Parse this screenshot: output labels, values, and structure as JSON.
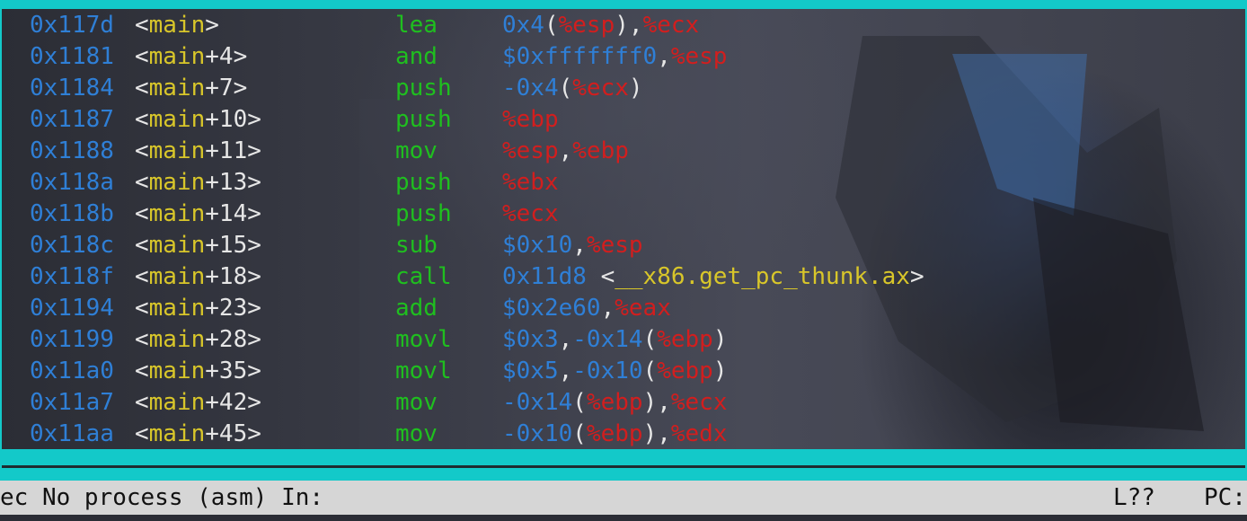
{
  "asm": {
    "rows": [
      {
        "addr": "0x117d",
        "sym": "main",
        "offset": "",
        "mnem": "lea",
        "ops": [
          [
            "num",
            "0x4"
          ],
          [
            "punc",
            "("
          ],
          [
            "reg",
            "%esp"
          ],
          [
            "punc",
            "),"
          ],
          [
            "reg",
            "%ecx"
          ]
        ]
      },
      {
        "addr": "0x1181",
        "sym": "main",
        "offset": "+4",
        "mnem": "and",
        "ops": [
          [
            "num",
            "$0xfffffff0"
          ],
          [
            "punc",
            ","
          ],
          [
            "reg",
            "%esp"
          ]
        ]
      },
      {
        "addr": "0x1184",
        "sym": "main",
        "offset": "+7",
        "mnem": "push",
        "ops": [
          [
            "num",
            "-0x4"
          ],
          [
            "punc",
            "("
          ],
          [
            "reg",
            "%ecx"
          ],
          [
            "punc",
            ")"
          ]
        ]
      },
      {
        "addr": "0x1187",
        "sym": "main",
        "offset": "+10",
        "mnem": "push",
        "ops": [
          [
            "reg",
            "%ebp"
          ]
        ]
      },
      {
        "addr": "0x1188",
        "sym": "main",
        "offset": "+11",
        "mnem": "mov",
        "ops": [
          [
            "reg",
            "%esp"
          ],
          [
            "punc",
            ","
          ],
          [
            "reg",
            "%ebp"
          ]
        ]
      },
      {
        "addr": "0x118a",
        "sym": "main",
        "offset": "+13",
        "mnem": "push",
        "ops": [
          [
            "reg",
            "%ebx"
          ]
        ]
      },
      {
        "addr": "0x118b",
        "sym": "main",
        "offset": "+14",
        "mnem": "push",
        "ops": [
          [
            "reg",
            "%ecx"
          ]
        ]
      },
      {
        "addr": "0x118c",
        "sym": "main",
        "offset": "+15",
        "mnem": "sub",
        "ops": [
          [
            "num",
            "$0x10"
          ],
          [
            "punc",
            ","
          ],
          [
            "reg",
            "%esp"
          ]
        ]
      },
      {
        "addr": "0x118f",
        "sym": "main",
        "offset": "+18",
        "mnem": "call",
        "ops": [
          [
            "num",
            "0x11d8"
          ],
          [
            "punc",
            " <"
          ],
          [
            "tsym",
            "__x86.get_pc_thunk.ax"
          ],
          [
            "punc",
            ">"
          ]
        ]
      },
      {
        "addr": "0x1194",
        "sym": "main",
        "offset": "+23",
        "mnem": "add",
        "ops": [
          [
            "num",
            "$0x2e60"
          ],
          [
            "punc",
            ","
          ],
          [
            "reg",
            "%eax"
          ]
        ]
      },
      {
        "addr": "0x1199",
        "sym": "main",
        "offset": "+28",
        "mnem": "movl",
        "ops": [
          [
            "num",
            "$0x3"
          ],
          [
            "punc",
            ","
          ],
          [
            "num",
            "-0x14"
          ],
          [
            "punc",
            "("
          ],
          [
            "reg",
            "%ebp"
          ],
          [
            "punc",
            ")"
          ]
        ]
      },
      {
        "addr": "0x11a0",
        "sym": "main",
        "offset": "+35",
        "mnem": "movl",
        "ops": [
          [
            "num",
            "$0x5"
          ],
          [
            "punc",
            ","
          ],
          [
            "num",
            "-0x10"
          ],
          [
            "punc",
            "("
          ],
          [
            "reg",
            "%ebp"
          ],
          [
            "punc",
            ")"
          ]
        ]
      },
      {
        "addr": "0x11a7",
        "sym": "main",
        "offset": "+42",
        "mnem": "mov",
        "ops": [
          [
            "num",
            "-0x14"
          ],
          [
            "punc",
            "("
          ],
          [
            "reg",
            "%ebp"
          ],
          [
            "punc",
            "),"
          ],
          [
            "reg",
            "%ecx"
          ]
        ]
      },
      {
        "addr": "0x11aa",
        "sym": "main",
        "offset": "+45",
        "mnem": "mov",
        "ops": [
          [
            "num",
            "-0x10"
          ],
          [
            "punc",
            "("
          ],
          [
            "reg",
            "%ebp"
          ],
          [
            "punc",
            "),"
          ],
          [
            "reg",
            "%edx"
          ]
        ]
      }
    ]
  },
  "status": {
    "left": "ec No process (asm) In:",
    "line": "L??",
    "pc": "PC:"
  },
  "colors": {
    "border": "#13c9c9",
    "address": "#2f7fd6",
    "symbol": "#d8c62a",
    "mnemonic": "#1fbf1f",
    "register": "#d21e1e",
    "status_bg": "#d6d6d6"
  }
}
